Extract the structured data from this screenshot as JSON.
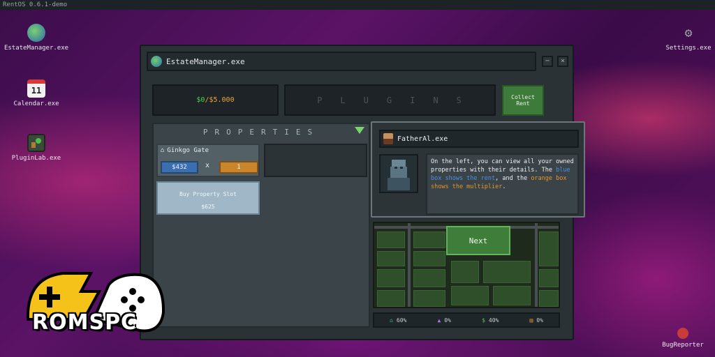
{
  "os": {
    "title": "RentOS 0.6.1-demo"
  },
  "desktop_icons": [
    {
      "label": "EstateManager.exe",
      "icon": "globe-icon"
    },
    {
      "label": "Calendar.exe",
      "icon": "calendar-icon",
      "day": "11"
    },
    {
      "label": "PluginLab.exe",
      "icon": "plugin-icon"
    },
    {
      "label": "Settings.exe",
      "icon": "gear-icon"
    },
    {
      "label": "BugReporter",
      "icon": "bug-icon"
    }
  ],
  "window": {
    "title": "EstateManager.exe",
    "minimize": "−",
    "close": "×"
  },
  "top": {
    "money_current": "$0",
    "money_sep": "/",
    "money_goal": "$5.000",
    "plugins_label": "PLUGINS",
    "collect_label": "Collect Rent"
  },
  "properties": {
    "header": "PROPERTIES",
    "items": [
      {
        "name": "Ginkgo Gate",
        "rent": "$432",
        "times": "x",
        "multiplier": "1"
      }
    ],
    "buy_slot": {
      "label": "Buy Property Slot",
      "price": "$625"
    }
  },
  "dialog": {
    "speaker": "FatherAl.exe",
    "text_a": "On the left, you can view all your owned properties with their details. The ",
    "text_blue": "blue box shows the rent",
    "text_b": ", and the ",
    "text_orange": "orange box shows the multiplier",
    "text_c": "."
  },
  "map": {
    "next_label": "Next"
  },
  "stats": [
    {
      "icon": "house-icon",
      "value": "60%",
      "color": "#4fb3a6"
    },
    {
      "icon": "tent-icon",
      "value": "0%",
      "color": "#b073d9"
    },
    {
      "icon": "dollar-icon",
      "value": "40%",
      "color": "#58c45a"
    },
    {
      "icon": "bars-icon",
      "value": "0%",
      "color": "#e3962f"
    }
  ],
  "logo": {
    "text": "ROMSPC"
  },
  "colors": {
    "accent_green": "#3e7a3a",
    "rent_blue": "#3b6fb0",
    "mult_orange": "#c9852a"
  }
}
